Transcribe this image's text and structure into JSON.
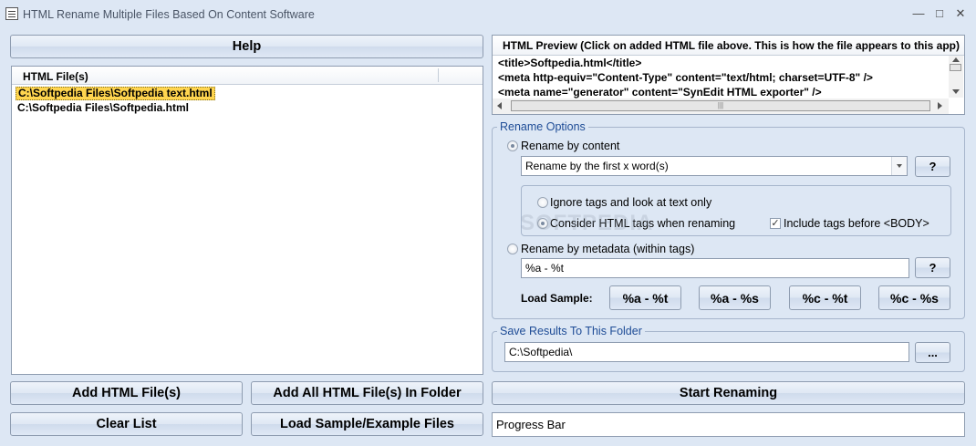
{
  "window": {
    "title": "HTML Rename Multiple Files Based On Content Software",
    "minimize_glyph": "—",
    "maximize_glyph": "□",
    "close_glyph": "✕"
  },
  "help_button": "Help",
  "file_list": {
    "header": "HTML File(s)",
    "items": [
      "C:\\Softpedia Files\\Softpedia text.html",
      "C:\\Softpedia Files\\Softpedia.html"
    ],
    "selected_index": 0
  },
  "preview": {
    "header": "HTML Preview (Click on added HTML file above. This is how the file appears to this app)",
    "lines": [
      "<title>Softpedia.html</title>",
      "<meta http-equiv=\"Content-Type\" content=\"text/html; charset=UTF-8\" />",
      "<meta name=\"generator\" content=\"SynEdit HTML exporter\" />"
    ],
    "hscroll_glyph": "|||"
  },
  "rename_options": {
    "title": "Rename Options",
    "by_content_label": "Rename by content",
    "content_mode_value": "Rename by the first x word(s)",
    "help_q": "?",
    "ignore_tags_label": "Ignore tags and look at text only",
    "consider_tags_label": "Consider HTML tags when renaming",
    "include_before_body_label": "Include tags before <BODY>",
    "by_metadata_label": "Rename by metadata (within tags)",
    "metadata_value": "%a - %t",
    "load_sample_label": "Load Sample:",
    "samples": [
      "%a - %t",
      "%a - %s",
      "%c - %t",
      "%c - %s"
    ]
  },
  "save_results": {
    "title": "Save Results To This Folder",
    "folder_value": "C:\\Softpedia\\",
    "browse_label": "..."
  },
  "bottom_buttons": {
    "add_files": "Add HTML File(s)",
    "add_folder": "Add All HTML File(s) In Folder",
    "start": "Start Renaming",
    "clear": "Clear List",
    "load_sample": "Load Sample/Example Files"
  },
  "progress_text": "Progress Bar",
  "watermark": "SOFTPEDIA",
  "colors": {
    "window_bg": "#dde7f4",
    "group_title": "#1e4c96",
    "selection": "#ffd54f"
  }
}
